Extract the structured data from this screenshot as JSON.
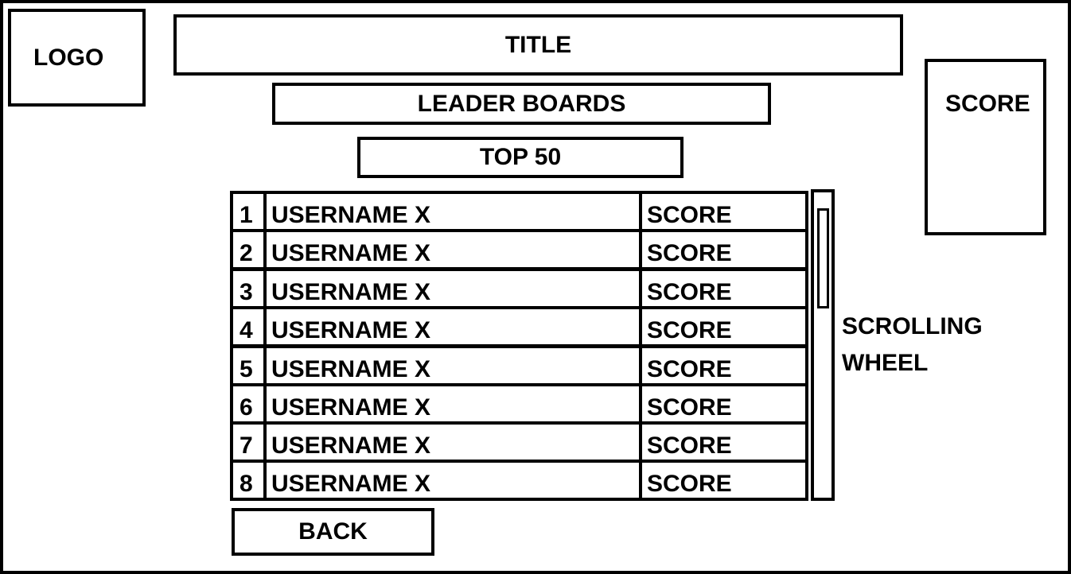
{
  "logo": "LOGO",
  "title": "TITLE",
  "leader_boards": "LEADER BOARDS",
  "top50": "TOP 50",
  "score_panel": "SCORE",
  "rows": [
    {
      "rank": "1",
      "username": "USERNAME X",
      "score": "SCORE"
    },
    {
      "rank": "2",
      "username": "USERNAME X",
      "score": "SCORE"
    },
    {
      "rank": "3",
      "username": "USERNAME X",
      "score": "SCORE"
    },
    {
      "rank": "4",
      "username": "USERNAME X",
      "score": "SCORE"
    },
    {
      "rank": "5",
      "username": "USERNAME X",
      "score": "SCORE"
    },
    {
      "rank": "6",
      "username": "USERNAME X",
      "score": "SCORE"
    },
    {
      "rank": "7",
      "username": "USERNAME X",
      "score": "SCORE"
    },
    {
      "rank": "8",
      "username": "USERNAME X",
      "score": "SCORE"
    }
  ],
  "scroll_note": {
    "line1": "SCROLLING",
    "line2": "WHEEL"
  },
  "back": "BACK"
}
